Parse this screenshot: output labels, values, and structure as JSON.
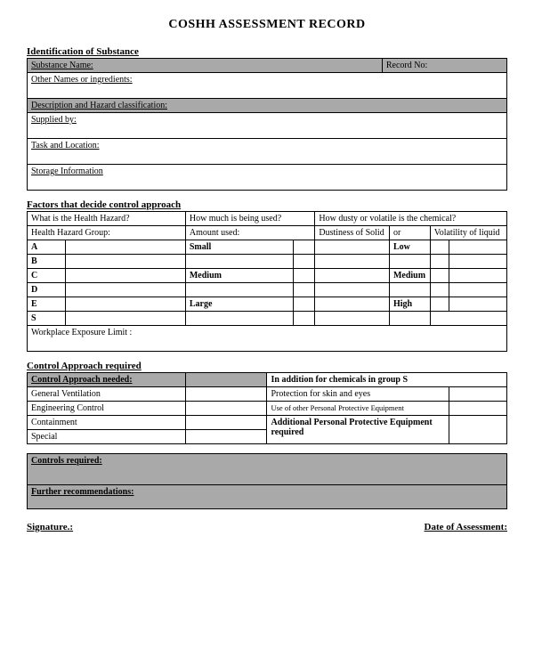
{
  "title": "COSHH ASSESSMENT RECORD",
  "section1": {
    "heading": "Identification of Substance",
    "substanceName": "Substance Name:",
    "recordNo": "Record No:",
    "otherNames": "Other Names or ingredients:",
    "description": "Description and Hazard classification:",
    "suppliedBy": "Supplied by:",
    "taskLocation": "Task and Location:",
    "storage": "Storage Information"
  },
  "section2": {
    "heading": "Factors that decide control approach",
    "q1": "What is the Health Hazard?",
    "q2": "How much is being used?",
    "q3": "How dusty or volatile is the chemical?",
    "hhg": "Health Hazard Group:",
    "amount": "Amount used:",
    "dustiness": "Dustiness of Solid",
    "or": "or",
    "volatility": "Volatility of liquid",
    "groups": [
      "A",
      "B",
      "C",
      "D",
      "E",
      "S"
    ],
    "amts": {
      "A": "Small",
      "C": "Medium",
      "E": "Large"
    },
    "dusts": {
      "A": "Low",
      "C": "Medium",
      "E": "High"
    },
    "wel": "Workplace Exposure Limit :"
  },
  "section3": {
    "heading": "Control Approach required",
    "ctrlNeeded": "Control Approach needed:",
    "additionGroupS": "In addition for chemicals in group S",
    "r1a": "General Ventilation",
    "r1b": "Protection for skin and eyes",
    "r2a": "Engineering Control",
    "r2b": "Use of other Personal Protective Equipment",
    "r3a": "Containment",
    "r3b": "Additional Personal Protective Equipment required",
    "r4a": "Special"
  },
  "section4": {
    "controlsReq": "Controls required:",
    "furtherRec": "Further recommendations:"
  },
  "footer": {
    "signature": "Signature.:",
    "dateAssess": "Date of Assessment:"
  }
}
